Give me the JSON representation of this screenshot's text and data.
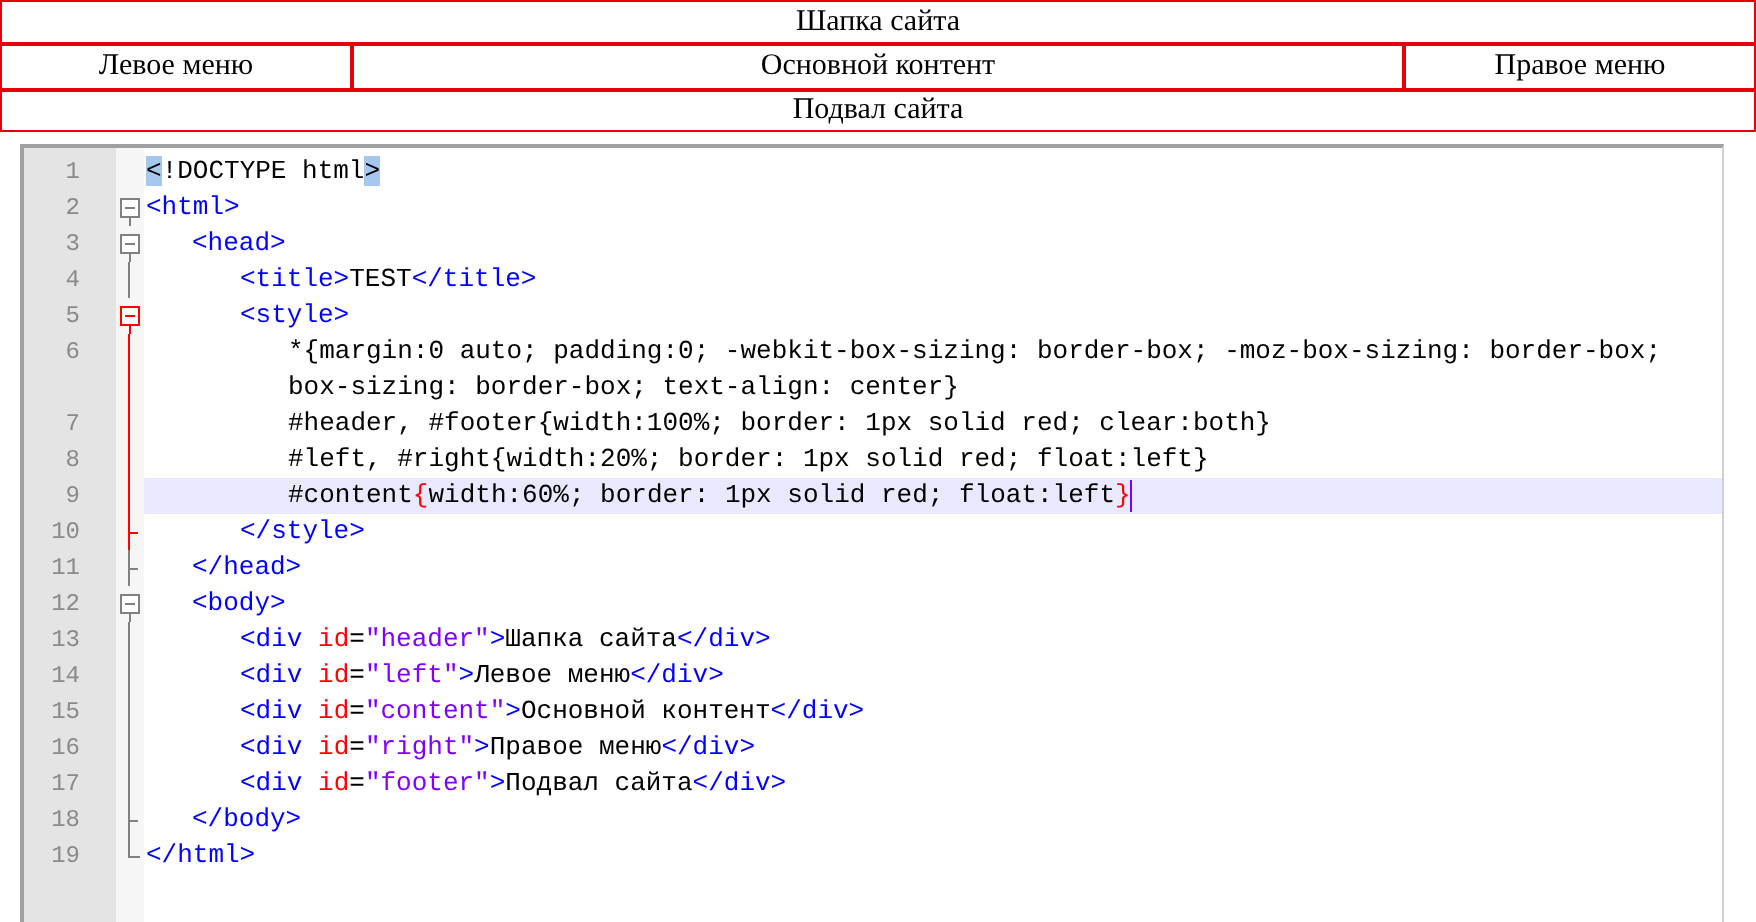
{
  "preview": {
    "header": "Шапка сайта",
    "left": "Левое меню",
    "content": "Основной контент",
    "right": "Правое меню",
    "footer": "Подвал сайта"
  },
  "editor": {
    "lines": [
      {
        "number": "1",
        "selected": false,
        "tokens": [
          {
            "kind": "highlight",
            "text": "<"
          },
          {
            "kind": "text",
            "text": "!DOCTYPE html"
          },
          {
            "kind": "highlight",
            "text": ">"
          }
        ]
      },
      {
        "number": "2",
        "selected": false,
        "fold": {
          "kind": "open",
          "active": false
        },
        "tokens": [
          {
            "kind": "tag",
            "text": "<html>"
          }
        ],
        "children": [
          {
            "number": "3",
            "selected": false,
            "fold": {
              "kind": "open",
              "active": false
            },
            "tokens": [
              {
                "kind": "tag",
                "text": "<head>"
              }
            ],
            "children": [
              {
                "number": "4",
                "selected": false,
                "fold": {
                  "kind": "line",
                  "active": false
                },
                "tokens": [
                  {
                    "kind": "tag",
                    "text": "<title>"
                  },
                  {
                    "kind": "text",
                    "text": "TEST"
                  },
                  {
                    "kind": "tag",
                    "text": "</title>"
                  }
                ]
              },
              {
                "number": "5",
                "selected": false,
                "fold": {
                  "kind": "open",
                  "active": true
                },
                "tokens": [
                  {
                    "kind": "tag",
                    "text": "<style>"
                  }
                ],
                "children": [
                  {
                    "number": "6",
                    "selected": false,
                    "fold": {
                      "kind": "line",
                      "active": true
                    },
                    "tokens": [
                      {
                        "kind": "text",
                        "text": "*{margin:0 auto; padding:0; -webkit-box-sizing: border-box; -moz-box-sizing: border-box; box-sizing: border-box; text-align: center}"
                      }
                    ]
                  },
                  {
                    "number": "7",
                    "selected": false,
                    "fold": {
                      "kind": "line",
                      "active": true
                    },
                    "tokens": [
                      {
                        "kind": "text",
                        "text": "#header, #footer{width:100%; border: 1px solid red; clear:both}"
                      }
                    ]
                  },
                  {
                    "number": "8",
                    "selected": false,
                    "fold": {
                      "kind": "line",
                      "active": true
                    },
                    "tokens": [
                      {
                        "kind": "text",
                        "text": "#left, #right{width:20%; border: 1px solid red; float:left}"
                      }
                    ]
                  },
                  {
                    "number": "9",
                    "selected": true,
                    "fold": {
                      "kind": "line",
                      "active": true
                    },
                    "tokens": [
                      {
                        "kind": "text",
                        "text": "#content"
                      },
                      {
                        "kind": "match",
                        "text": "{"
                      },
                      {
                        "kind": "text",
                        "text": "width:60%; border: 1px solid red; float:left"
                      },
                      {
                        "kind": "match",
                        "text": "}"
                      }
                    ]
                  }
                ]
              },
              {
                "number": "10",
                "selected": false,
                "fold": {
                  "kind": "end",
                  "active": true
                },
                "tokens": [
                  {
                    "kind": "tag",
                    "text": "</style>"
                  }
                ]
              }
            ]
          },
          {
            "number": "11",
            "selected": false,
            "fold": {
              "kind": "end",
              "active": false
            },
            "tokens": [
              {
                "kind": "tag",
                "text": "</head>"
              }
            ]
          },
          {
            "number": "12",
            "selected": false,
            "fold": {
              "kind": "open",
              "active": false
            },
            "tokens": [
              {
                "kind": "tag",
                "text": "<body>"
              }
            ],
            "children": [
              {
                "number": "13",
                "selected": false,
                "fold": {
                  "kind": "line",
                  "active": false
                },
                "tokens": [
                  {
                    "kind": "tag",
                    "text": "<div "
                  },
                  {
                    "kind": "attr",
                    "text": "id"
                  },
                  {
                    "kind": "text",
                    "text": "="
                  },
                  {
                    "kind": "string",
                    "text": "\"header\""
                  },
                  {
                    "kind": "tag",
                    "text": ">"
                  },
                  {
                    "kind": "text",
                    "text": "Шапка сайта"
                  },
                  {
                    "kind": "tag",
                    "text": "</div>"
                  }
                ]
              },
              {
                "number": "14",
                "selected": false,
                "fold": {
                  "kind": "line",
                  "active": false
                },
                "tokens": [
                  {
                    "kind": "tag",
                    "text": "<div "
                  },
                  {
                    "kind": "attr",
                    "text": "id"
                  },
                  {
                    "kind": "text",
                    "text": "="
                  },
                  {
                    "kind": "string",
                    "text": "\"left\""
                  },
                  {
                    "kind": "tag",
                    "text": ">"
                  },
                  {
                    "kind": "text",
                    "text": "Левое меню"
                  },
                  {
                    "kind": "tag",
                    "text": "</div>"
                  }
                ]
              },
              {
                "number": "15",
                "selected": false,
                "fold": {
                  "kind": "line",
                  "active": false
                },
                "tokens": [
                  {
                    "kind": "tag",
                    "text": "<div "
                  },
                  {
                    "kind": "attr",
                    "text": "id"
                  },
                  {
                    "kind": "text",
                    "text": "="
                  },
                  {
                    "kind": "string",
                    "text": "\"content\""
                  },
                  {
                    "kind": "tag",
                    "text": ">"
                  },
                  {
                    "kind": "text",
                    "text": "Основной контент"
                  },
                  {
                    "kind": "tag",
                    "text": "</div>"
                  }
                ]
              },
              {
                "number": "16",
                "selected": false,
                "fold": {
                  "kind": "line",
                  "active": false
                },
                "tokens": [
                  {
                    "kind": "tag",
                    "text": "<div "
                  },
                  {
                    "kind": "attr",
                    "text": "id"
                  },
                  {
                    "kind": "text",
                    "text": "="
                  },
                  {
                    "kind": "string",
                    "text": "\"right\""
                  },
                  {
                    "kind": "tag",
                    "text": ">"
                  },
                  {
                    "kind": "text",
                    "text": "Правое меню"
                  },
                  {
                    "kind": "tag",
                    "text": "</div>"
                  }
                ]
              },
              {
                "number": "17",
                "selected": false,
                "fold": {
                  "kind": "line",
                  "active": false
                },
                "tokens": [
                  {
                    "kind": "tag",
                    "text": "<div "
                  },
                  {
                    "kind": "attr",
                    "text": "id"
                  },
                  {
                    "kind": "text",
                    "text": "="
                  },
                  {
                    "kind": "string",
                    "text": "\"footer\""
                  },
                  {
                    "kind": "tag",
                    "text": ">"
                  },
                  {
                    "kind": "text",
                    "text": "Подвал сайта"
                  },
                  {
                    "kind": "tag",
                    "text": "</div>"
                  }
                ]
              }
            ]
          },
          {
            "number": "18",
            "selected": false,
            "fold": {
              "kind": "end",
              "active": false
            },
            "tokens": [
              {
                "kind": "tag",
                "text": "</body>"
              }
            ]
          }
        ]
      },
      {
        "number": "19",
        "selected": false,
        "fold": {
          "kind": "close",
          "active": false
        },
        "tokens": [
          {
            "kind": "tag",
            "text": "</html>"
          }
        ]
      }
    ]
  }
}
